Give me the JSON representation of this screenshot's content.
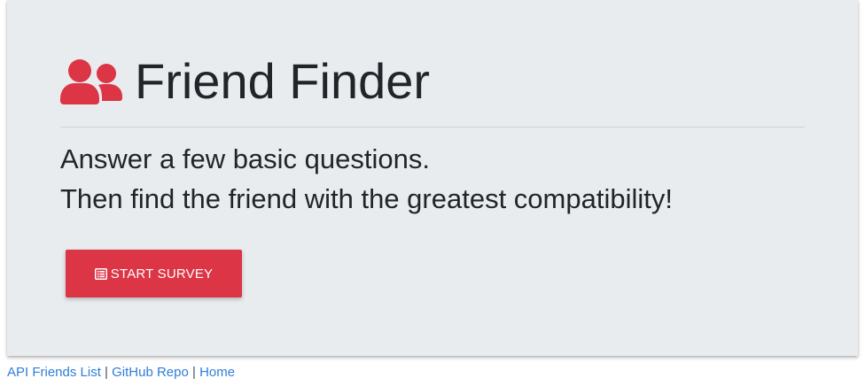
{
  "header": {
    "title": "Friend Finder",
    "icon": "users-icon",
    "accent_color": "#dc3545"
  },
  "lead": {
    "line1": "Answer a few basic questions.",
    "line2": "Then find the friend with the greatest compatibility!"
  },
  "actions": {
    "start_survey_label": "START SURVEY",
    "start_survey_icon": "list-alt-icon"
  },
  "footer": {
    "links": [
      {
        "label": "API Friends List"
      },
      {
        "label": "GitHub Repo"
      },
      {
        "label": "Home"
      }
    ],
    "separator": "|"
  }
}
